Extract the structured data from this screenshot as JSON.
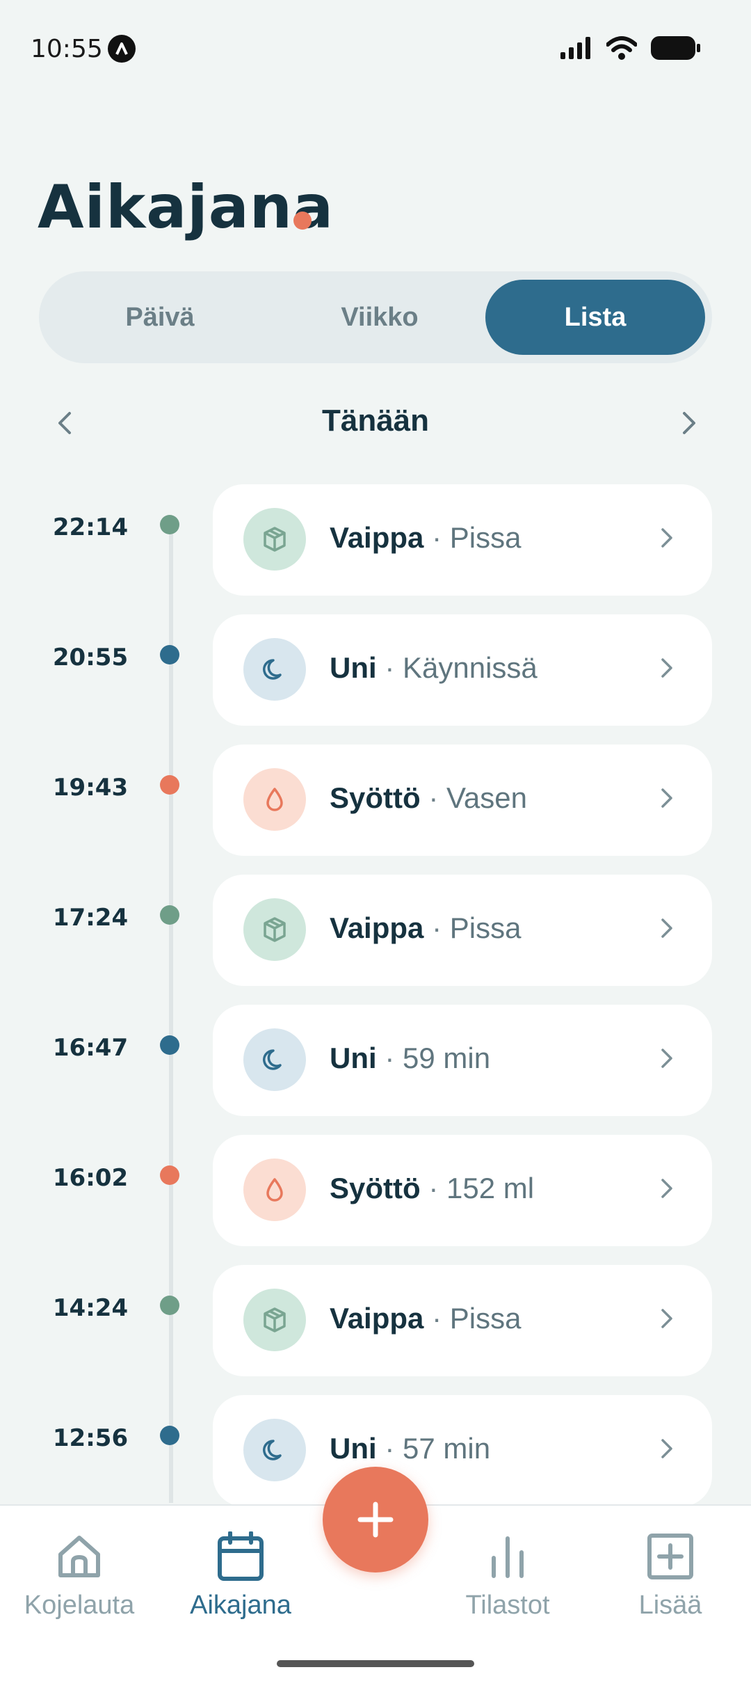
{
  "status_bar": {
    "time": "10:55"
  },
  "header": {
    "title": "Aikajana"
  },
  "segments": [
    {
      "label": "Päivä",
      "active": false
    },
    {
      "label": "Viikko",
      "active": false
    },
    {
      "label": "Lista",
      "active": true
    }
  ],
  "date_nav": {
    "label": "Tänään"
  },
  "colors": {
    "accent": "#2e6c8d",
    "coral": "#e8785c",
    "diaper": "#6f9e88",
    "sleep": "#2e6c8d",
    "feeding": "#e8785c"
  },
  "timeline": [
    {
      "time": "22:14",
      "type": "diaper",
      "icon": "box-icon",
      "title": "Vaippa",
      "separator": "·",
      "detail": "Pissa"
    },
    {
      "time": "20:55",
      "type": "sleep",
      "icon": "moon-icon",
      "title": "Uni",
      "separator": "·",
      "detail": "Käynnissä"
    },
    {
      "time": "19:43",
      "type": "feeding",
      "icon": "drop-icon",
      "title": "Syöttö",
      "separator": "·",
      "detail": "Vasen"
    },
    {
      "time": "17:24",
      "type": "diaper",
      "icon": "box-icon",
      "title": "Vaippa",
      "separator": "·",
      "detail": "Pissa"
    },
    {
      "time": "16:47",
      "type": "sleep",
      "icon": "moon-icon",
      "title": "Uni",
      "separator": "·",
      "detail": "59 min"
    },
    {
      "time": "16:02",
      "type": "feeding",
      "icon": "drop-icon",
      "title": "Syöttö",
      "separator": "·",
      "detail": "152 ml"
    },
    {
      "time": "14:24",
      "type": "diaper",
      "icon": "box-icon",
      "title": "Vaippa",
      "separator": "·",
      "detail": "Pissa"
    },
    {
      "time": "12:56",
      "type": "sleep",
      "icon": "moon-icon",
      "title": "Uni",
      "separator": "·",
      "detail": "57 min"
    }
  ],
  "bottom_nav": [
    {
      "label": "Kojelauta",
      "icon": "home-icon",
      "active": false
    },
    {
      "label": "Aikajana",
      "icon": "calendar-icon",
      "active": true
    },
    {
      "label": "Tilastot",
      "icon": "bar-chart-icon",
      "active": false
    },
    {
      "label": "Lisää",
      "icon": "plus-square-icon",
      "active": false
    }
  ],
  "fab": {
    "icon": "plus-icon"
  }
}
